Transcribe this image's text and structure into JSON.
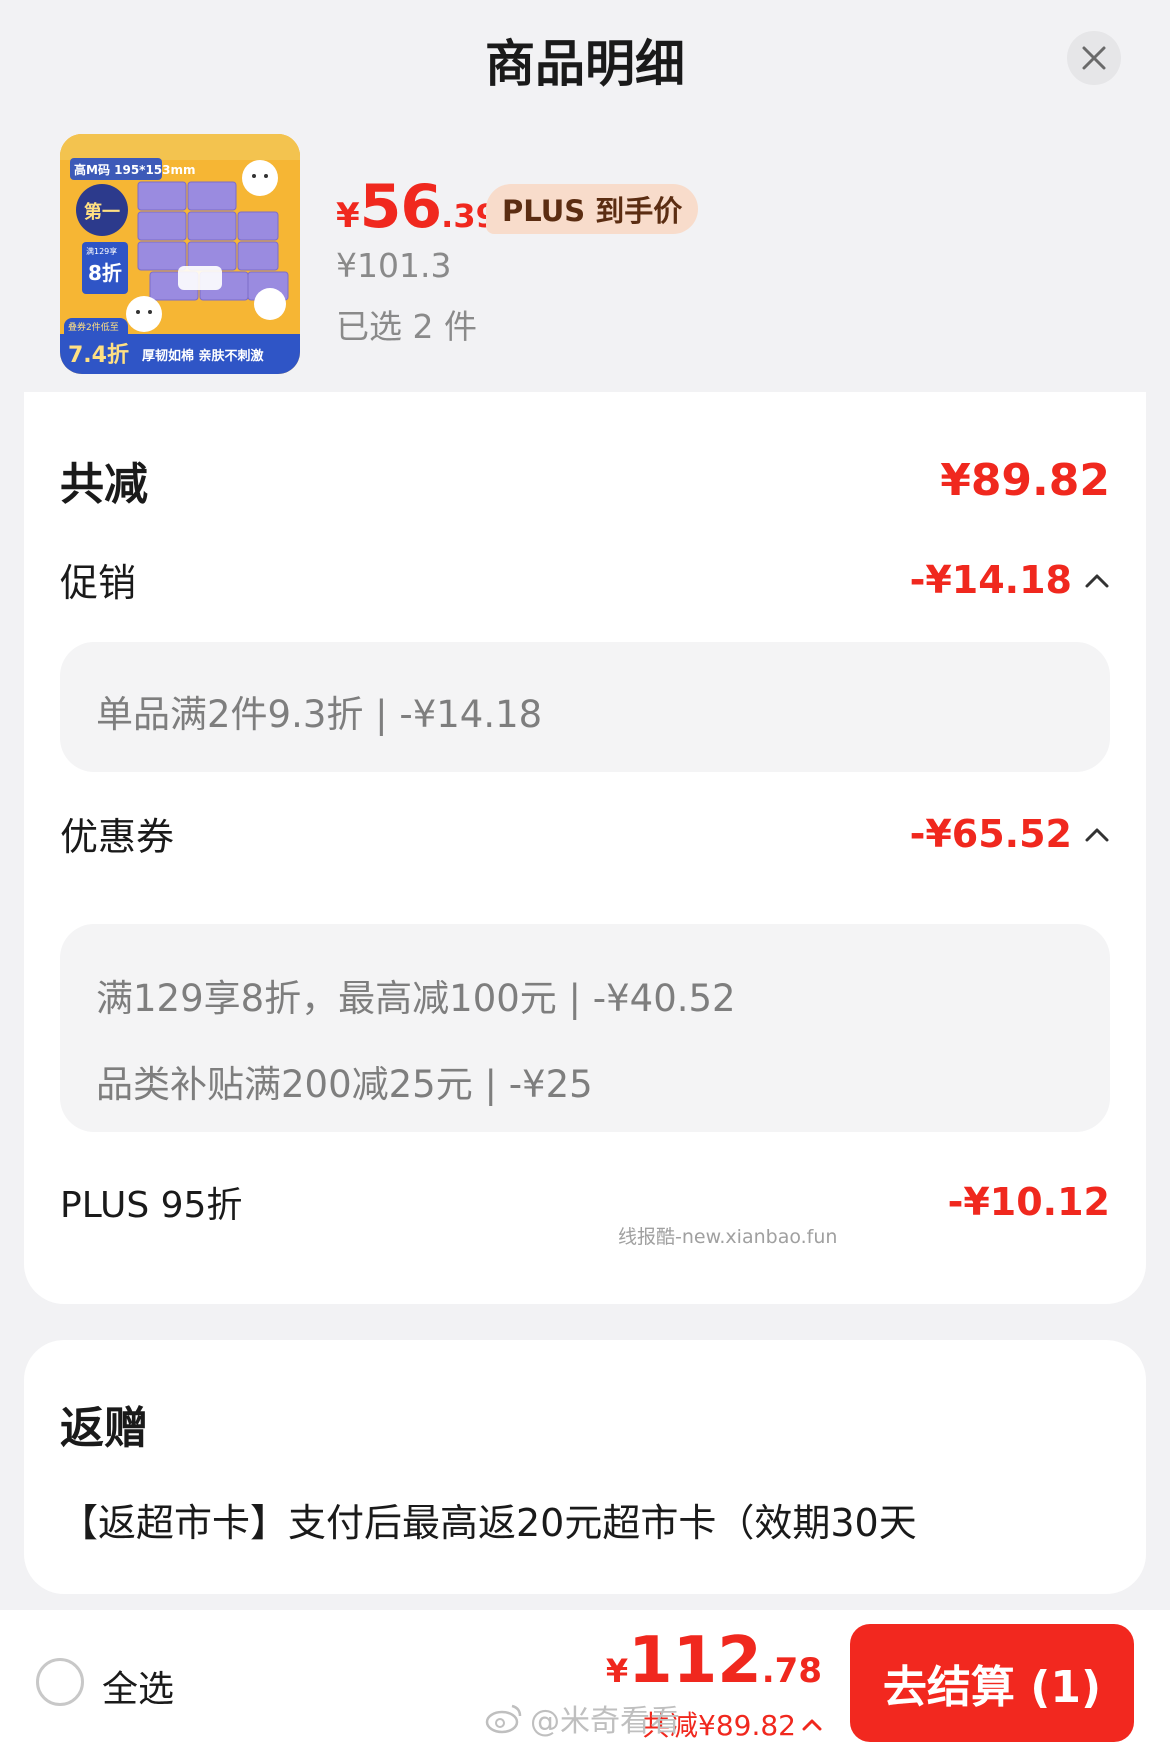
{
  "header": {
    "title": "商品明细"
  },
  "product": {
    "price_yen": "¥",
    "price_int": "56",
    "price_dec": ".39",
    "plus_badge": "PLUS 到手价",
    "original_price": "¥101.3",
    "selected_count": "已选 2 件",
    "image_texts": {
      "size": "高M码 195*153mm",
      "rank": "第一",
      "discount": "8折",
      "discount_note": "满129享",
      "promo_price": "7.4折",
      "promo_note": "叠券2件低至",
      "slogan": "厚韧如棉 亲肤不刺激"
    }
  },
  "summary": {
    "total_discount_label": "共减",
    "total_discount_value": "¥89.82",
    "promotion": {
      "label": "促销",
      "value": "-¥14.18",
      "details": [
        "单品满2件9.3折 | -¥14.18"
      ]
    },
    "coupon": {
      "label": "优惠券",
      "value": "-¥65.52",
      "details": [
        "满129享8折，最高减100元 | -¥40.52",
        "品类补贴满200减25元 | -¥25"
      ]
    },
    "plus": {
      "label": "PLUS 95折",
      "value": "-¥10.12"
    },
    "watermark": "线报酷-new.xianbao.fun"
  },
  "rebate": {
    "title": "返赠",
    "text": "【返超市卡】支付后最高返20元超市卡（效期30天"
  },
  "footer": {
    "select_all": "全选",
    "total_yen": "¥",
    "total_int": "112",
    "total_dec": ".78",
    "total_discount": "共减¥89.82",
    "checkout": "去结算 (1)",
    "weibo_watermark": "@米奇看看"
  },
  "colors": {
    "accent": "#f0281e",
    "badge_bg": "#f8dccb",
    "badge_text": "#5b2d12"
  }
}
